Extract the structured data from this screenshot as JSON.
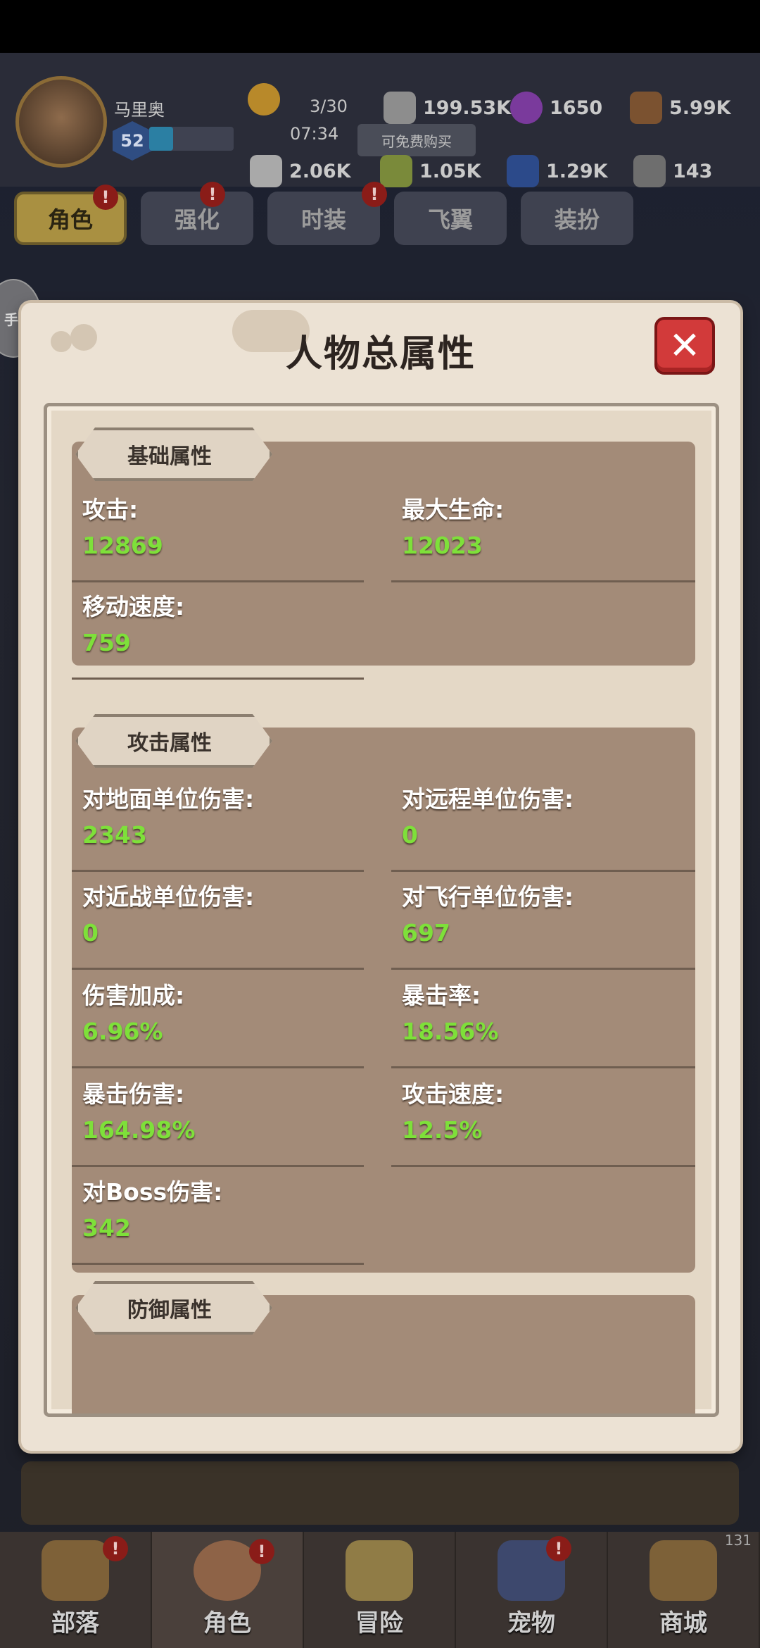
{
  "header": {
    "player_name": "马里奥",
    "player_level": "52",
    "energy_count": "3/30",
    "energy_timer": "07:34",
    "free_buy_label": "可免费购买",
    "resources": [
      {
        "icon": "silver-ore-icon",
        "value": "199.53K"
      },
      {
        "icon": "purple-gem-icon",
        "value": "1650"
      },
      {
        "icon": "wood-log-icon",
        "value": "5.99K"
      },
      {
        "icon": "bone-icon",
        "value": "2.06K"
      },
      {
        "icon": "green-stone-icon",
        "value": "1.05K"
      },
      {
        "icon": "blue-crystal-icon",
        "value": "1.29K"
      },
      {
        "icon": "rock-icon",
        "value": "143"
      }
    ]
  },
  "tabs": [
    "角色",
    "强化",
    "时装",
    "飞翼",
    "装扮"
  ],
  "side_bubble": "手游",
  "modal": {
    "title": "人物总属性",
    "sections": {
      "basic": {
        "title": "基础属性",
        "stats": [
          {
            "label": "攻击:",
            "value": "12869"
          },
          {
            "label": "最大生命:",
            "value": "12023"
          },
          {
            "label": "移动速度:",
            "value": "759"
          }
        ]
      },
      "attack": {
        "title": "攻击属性",
        "stats": [
          {
            "label": "对地面单位伤害:",
            "value": "2343"
          },
          {
            "label": "对远程单位伤害:",
            "value": "0"
          },
          {
            "label": "对近战单位伤害:",
            "value": "0"
          },
          {
            "label": "对飞行单位伤害:",
            "value": "697"
          },
          {
            "label": "伤害加成:",
            "value": "6.96%"
          },
          {
            "label": "暴击率:",
            "value": "18.56%"
          },
          {
            "label": "暴击伤害:",
            "value": "164.98%"
          },
          {
            "label": "攻击速度:",
            "value": "12.5%"
          },
          {
            "label": "对Boss伤害:",
            "value": "342"
          }
        ]
      },
      "defense": {
        "title": "防御属性"
      }
    }
  },
  "bottom_nav": [
    {
      "label": "部落",
      "icon": "tribe-icon"
    },
    {
      "label": "角色",
      "icon": "character-icon"
    },
    {
      "label": "冒险",
      "icon": "map-icon"
    },
    {
      "label": "宠物",
      "icon": "pet-icon"
    },
    {
      "label": "商城",
      "icon": "shop-icon",
      "count": "131"
    }
  ],
  "colors": {
    "stat_value": "#7ee03a",
    "close_button": "#d23a3a",
    "panel": "#a38b78",
    "modal_bg": "#ece2d4"
  }
}
